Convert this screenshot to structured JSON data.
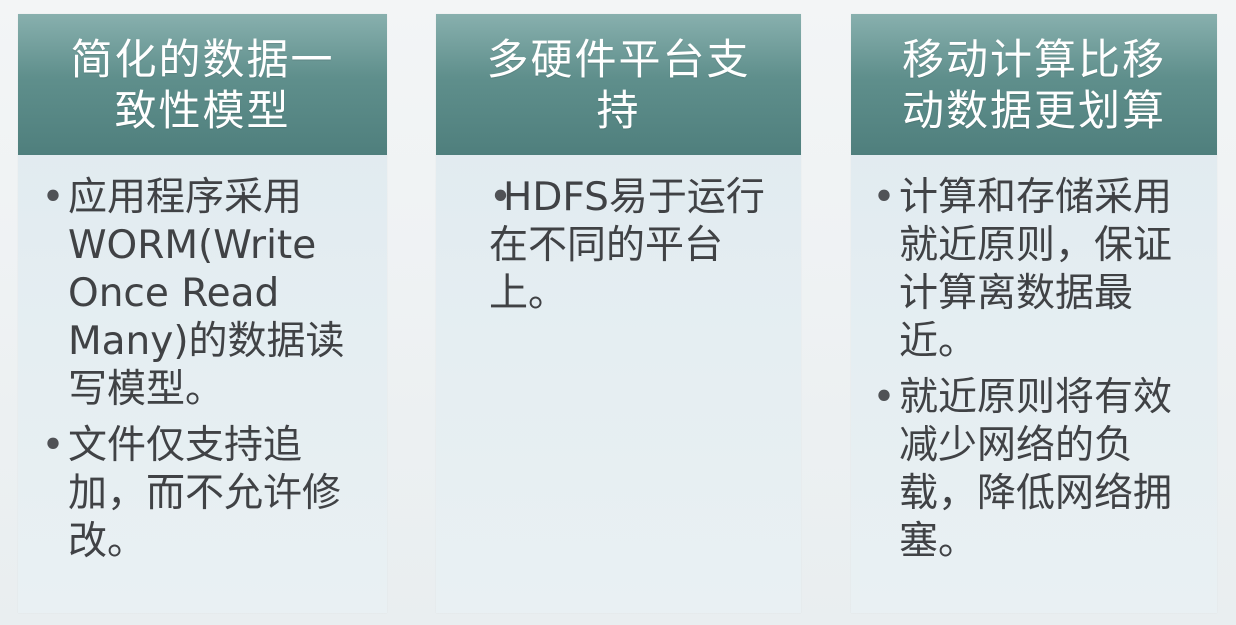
{
  "columns": [
    {
      "title": "简化的数据一致性模型",
      "bullets": [
        "应用程序采用WORM(Write Once Read Many)的数据读写模型。",
        "文件仅支持追加，而不允许修改。"
      ]
    },
    {
      "title": "多硬件平台支持",
      "bullets": [
        "HDFS易于运行在不同的平台上。"
      ]
    },
    {
      "title": "移动计算比移动数据更划算",
      "bullets": [
        "计算和存储采用就近原则，保证计算离数据最近。",
        "就近原则将有效减少网络的负载，降低网络拥塞。"
      ]
    }
  ],
  "bullet_symbol": "•"
}
